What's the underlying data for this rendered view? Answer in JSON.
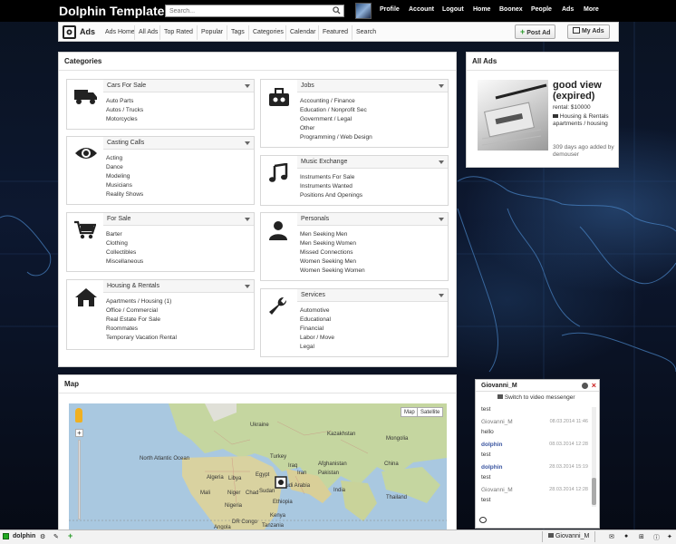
{
  "header": {
    "site_title": "Dolphin Template",
    "search_placeholder": "Search...",
    "nav": [
      "Profile",
      "Account",
      "Logout",
      "Home",
      "Boonex",
      "People",
      "Ads",
      "More"
    ]
  },
  "subnav": {
    "title": "Ads",
    "tabs": [
      "Ads Home",
      "All Ads",
      "Top Rated",
      "Popular",
      "Tags",
      "Categories",
      "Calendar",
      "Featured",
      "Search"
    ],
    "post_ad_label": "Post Ad",
    "my_ads_label": "My Ads"
  },
  "categories": {
    "title": "Categories",
    "left": [
      {
        "name": "Cars For Sale",
        "icon": "truck-icon",
        "items": [
          "Auto Parts",
          "Autos / Trucks",
          "Motorcycles"
        ]
      },
      {
        "name": "Casting Calls",
        "icon": "eye-icon",
        "items": [
          "Acting",
          "Dance",
          "Modeling",
          "Musicians",
          "Reality Shows"
        ]
      },
      {
        "name": "For Sale",
        "icon": "cart-icon",
        "items": [
          "Barter",
          "Clothing",
          "Collectibles",
          "Miscellaneous"
        ]
      },
      {
        "name": "Housing & Rentals",
        "icon": "house-icon",
        "items": [
          "Apartments / Housing (1)",
          "Office / Commercial",
          "Real Estate For Sale",
          "Roommates",
          "Temporary Vacation Rental"
        ]
      }
    ],
    "right": [
      {
        "name": "Jobs",
        "icon": "briefcase-icon",
        "items": [
          "Accounting / Finance",
          "Education / Nonprofit Sec",
          "Government / Legal",
          "Other",
          "Programming / Web Design"
        ]
      },
      {
        "name": "Music Exchange",
        "icon": "music-note-icon",
        "items": [
          "Instruments For Sale",
          "Instruments Wanted",
          "Positions And Openings"
        ]
      },
      {
        "name": "Personals",
        "icon": "person-icon",
        "items": [
          "Men Seeking Men",
          "Men Seeking Women",
          "Missed Connections",
          "Women Seeking Men",
          "Women Seeking Women"
        ]
      },
      {
        "name": "Services",
        "icon": "wrench-icon",
        "items": [
          "Automotive",
          "Educational",
          "Financial",
          "Labor / Move",
          "Legal"
        ]
      }
    ]
  },
  "all_ads": {
    "title": "All Ads",
    "ad": {
      "title": "good view (expired)",
      "price": "rental: $10000",
      "category": "Housing & Rentals apartments / housing",
      "posted": "309 days ago",
      "added_by": "added by demouser"
    }
  },
  "map": {
    "title": "Map",
    "toggle": [
      "Map",
      "Satellite"
    ],
    "labels": [
      "North Atlantic Ocean",
      "Algeria",
      "Libya",
      "Egypt",
      "Saudi Arabia",
      "Iran",
      "India",
      "China",
      "Kazakhstan",
      "Mongolia",
      "Turkey",
      "Ukraine",
      "Mali",
      "Niger",
      "Chad",
      "Sudan",
      "Nigeria",
      "Ethiopia",
      "Kenya",
      "Tanzania",
      "DR Congo",
      "Angola",
      "Pakistan",
      "Afghanistan",
      "Iraq",
      "Thailand"
    ]
  },
  "chat": {
    "user": "Giovanni_M",
    "switch_label": "Switch to video messenger",
    "messages": [
      {
        "who": "",
        "time": "",
        "text": "test"
      },
      {
        "who": "Giovanni_M",
        "time": "08.03.2014 11:46",
        "text": "hello"
      },
      {
        "who": "dolphin",
        "time": "08.03.2014 12:28",
        "text": "test"
      },
      {
        "who": "dolphin",
        "time": "28.03.2014 15:19",
        "text": "test"
      },
      {
        "who": "Giovanni_M",
        "time": "28.03.2014 12:28",
        "text": "test"
      }
    ]
  },
  "bottombar": {
    "user": "dolphin",
    "chat_user": "Giovanni_M"
  }
}
